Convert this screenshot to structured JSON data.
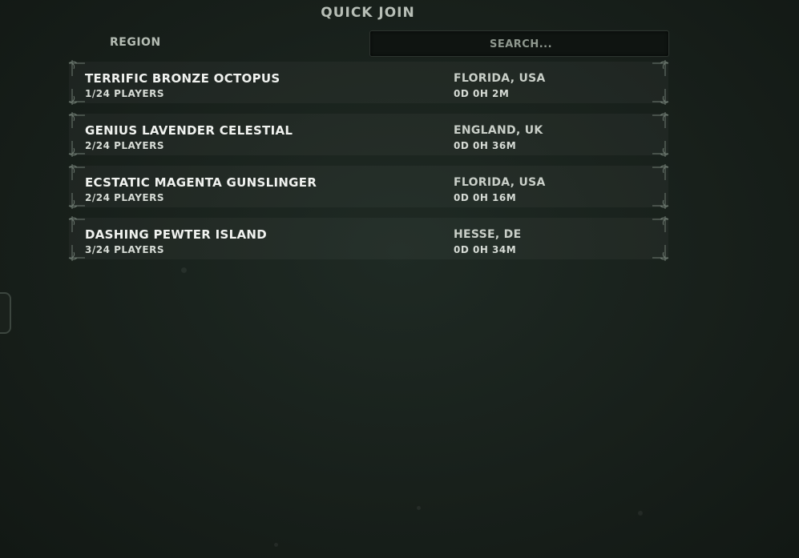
{
  "header": {
    "title": "QUICK JOIN"
  },
  "filters": {
    "region_label": "REGION",
    "search_placeholder": "SEARCH..."
  },
  "servers": [
    {
      "name": "TERRIFIC BRONZE OCTOPUS",
      "players": "1/24 PLAYERS",
      "location": "FLORIDA, USA",
      "uptime": "0D 0H 2M"
    },
    {
      "name": "GENIUS LAVENDER CELESTIAL",
      "players": "2/24 PLAYERS",
      "location": "ENGLAND, UK",
      "uptime": "0D 0H 36M"
    },
    {
      "name": "ECSTATIC MAGENTA GUNSLINGER",
      "players": "2/24 PLAYERS",
      "location": "FLORIDA, USA",
      "uptime": "0D 0H 16M"
    },
    {
      "name": "DASHING PEWTER ISLAND",
      "players": "3/24 PLAYERS",
      "location": "HESSE, DE",
      "uptime": "0D 0H 34M"
    }
  ]
}
